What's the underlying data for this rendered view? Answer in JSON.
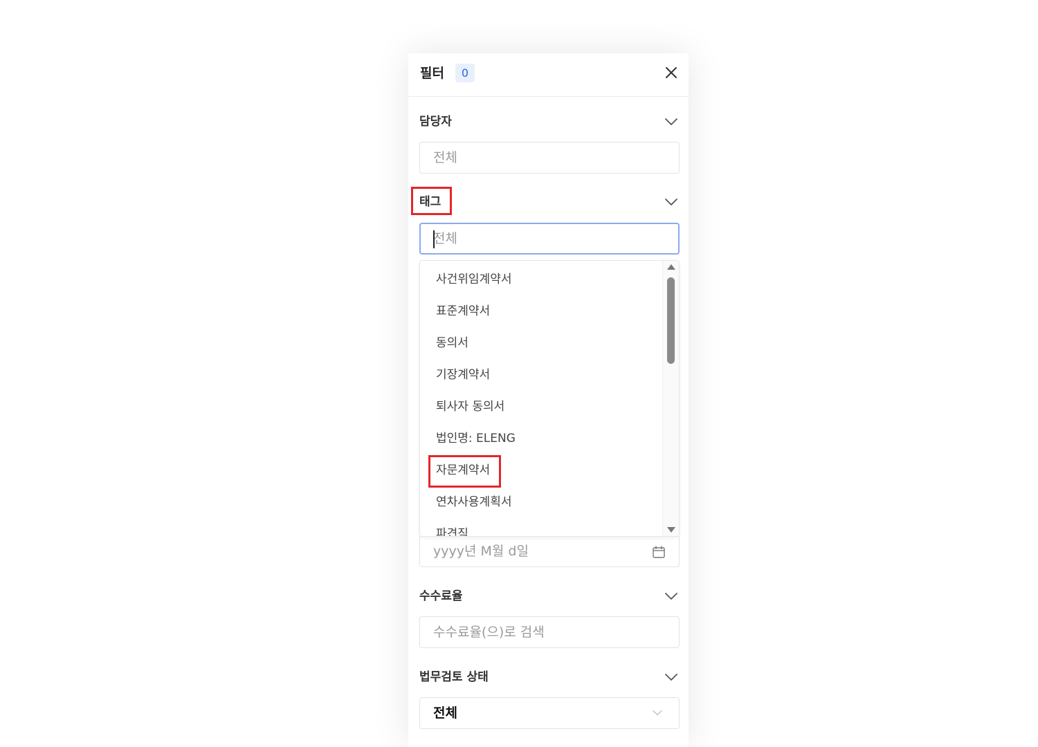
{
  "filter": {
    "title": "필터",
    "count": "0",
    "icons": {
      "close": "close-icon",
      "section_toggle": "chevron-down-icon",
      "calendar": "calendar-icon",
      "scroll_up": "triangle-up-icon",
      "scroll_down": "triangle-down-icon"
    }
  },
  "assignee": {
    "label": "담당자",
    "placeholder": "전체"
  },
  "tag": {
    "label": "태그",
    "placeholder": "전체",
    "options": [
      "사건위임계약서",
      "표준계약서",
      "동의서",
      "기장계약서",
      "퇴사자 동의서",
      "법인명: ELENG",
      "자문계약서",
      "연차사용계획서",
      "파견직"
    ]
  },
  "date": {
    "placeholder": "yyyy년 M월 d일"
  },
  "fee_rate": {
    "label": "수수료율",
    "placeholder": "수수료율(으)로 검색"
  },
  "legal_review": {
    "label": "법무검토 상태",
    "selected": "전체"
  },
  "colors": {
    "accent": "#2f62e6",
    "badge_bg": "#e8effd",
    "focus_border": "#8ea9ee",
    "highlight": "#e3262b",
    "scroll_thumb": "#8a8a8a"
  }
}
